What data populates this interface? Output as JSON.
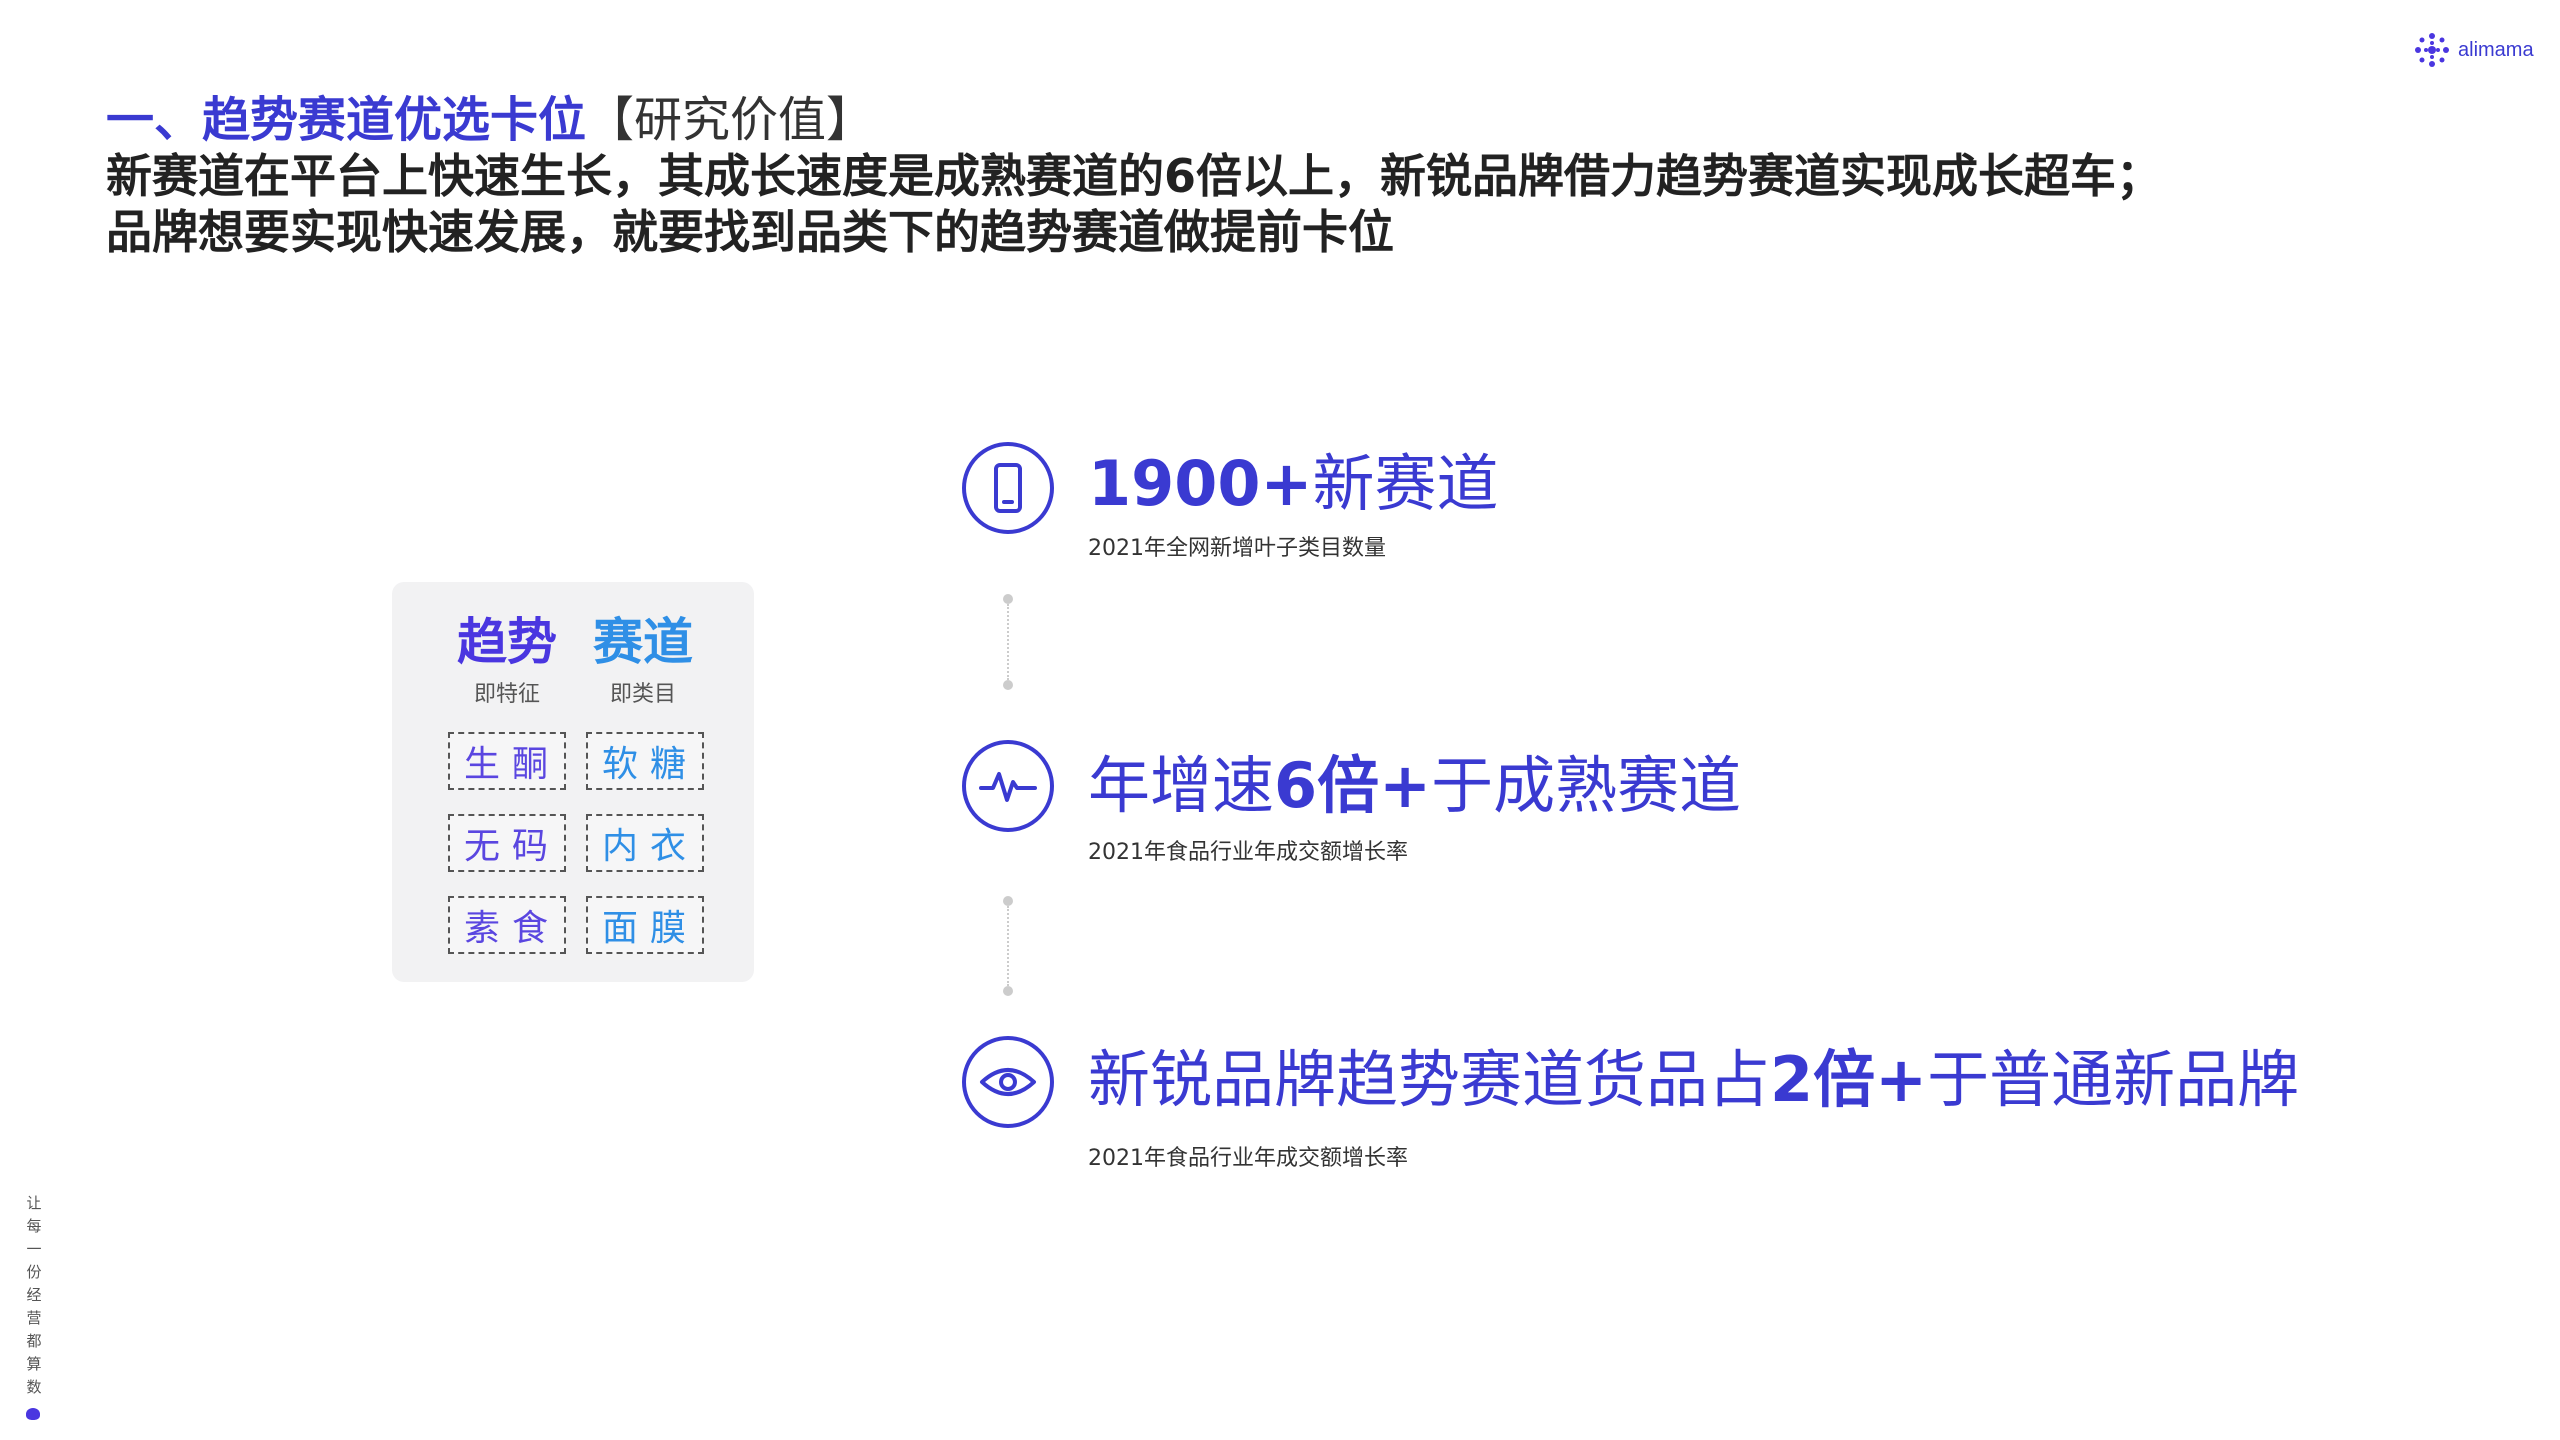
{
  "logo": {
    "text": "alimama"
  },
  "header": {
    "title_prefix": "一、趋势赛道优选卡位",
    "title_bracket": "【研究价值】",
    "line2": "新赛道在平台上快速生长，其成长速度是成熟赛道的6倍以上，新锐品牌借力趋势赛道实现成长超车；",
    "line3": "品牌想要实现快速发展，就要找到品类下的趋势赛道做提前卡位"
  },
  "card": {
    "head1": {
      "title": "趋势",
      "sub": "即特征"
    },
    "head2": {
      "title": "赛道",
      "sub": "即类目"
    },
    "tags": [
      {
        "left": "生酮",
        "right": "软糖"
      },
      {
        "left": "无码",
        "right": "内衣"
      },
      {
        "left": "素食",
        "right": "面膜"
      }
    ]
  },
  "stats": [
    {
      "icon": "phone-icon",
      "bold": "1900+",
      "text": "新赛道",
      "sub": "2021年全网新增叶子类目数量"
    },
    {
      "icon": "pulse-icon",
      "pre": "年增速",
      "bold": "6倍+",
      "text": "于成熟赛道",
      "sub": "2021年食品行业年成交额增长率"
    },
    {
      "icon": "eye-icon",
      "pre": "新锐品牌趋势赛道货品占",
      "bold": "2倍+",
      "text": "于普通新品牌",
      "sub": "2021年食品行业年成交额增长率"
    }
  ],
  "side_text": [
    "让",
    "每",
    "一",
    "份",
    "经",
    "营",
    "都",
    "算",
    "数"
  ],
  "colors": {
    "accent": "#3a3ad1",
    "blue": "#2f8fe6",
    "purple": "#4a36e0"
  }
}
